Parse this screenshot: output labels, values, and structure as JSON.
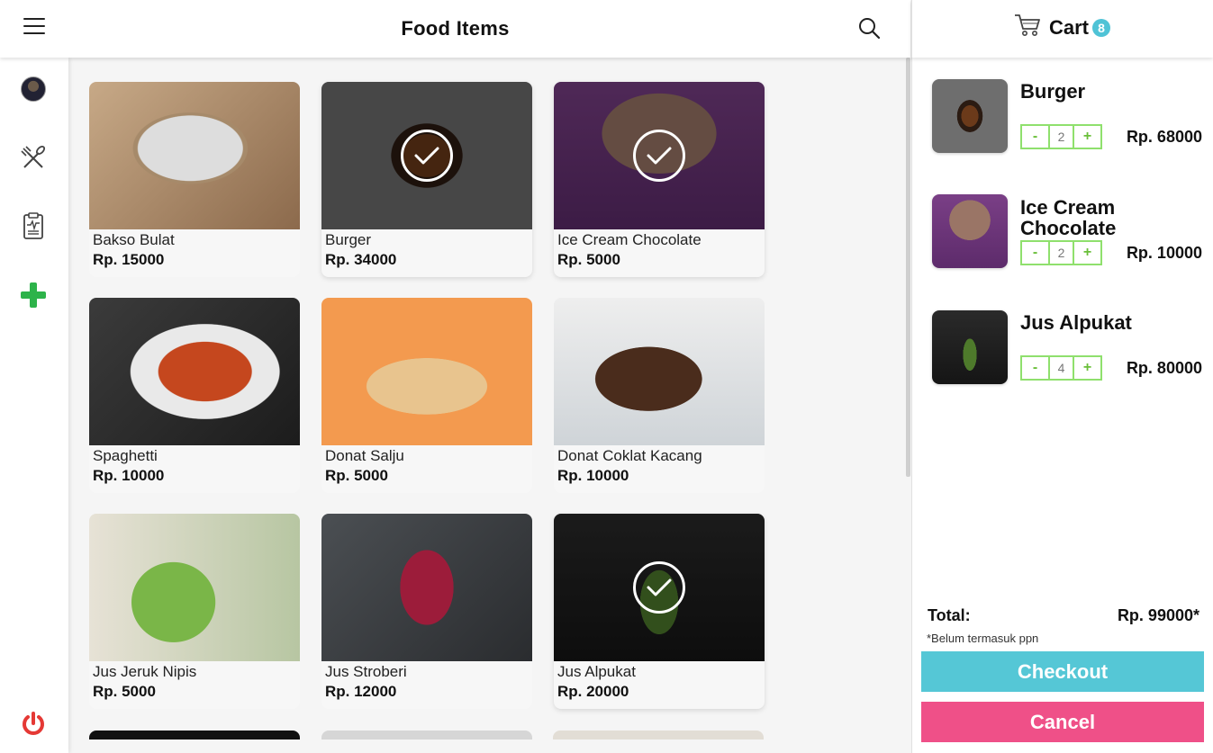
{
  "header": {
    "title": "Food Items"
  },
  "cart_header": {
    "title": "Cart",
    "count": "8"
  },
  "menu": [
    {
      "name": "Bakso Bulat",
      "price": "Rp. 15000",
      "selected": false,
      "img": "img-bakso"
    },
    {
      "name": "Burger",
      "price": "Rp. 34000",
      "selected": true,
      "img": "img-burger"
    },
    {
      "name": "Ice Cream Chocolate",
      "price": "Rp. 5000",
      "selected": true,
      "img": "img-icecream"
    },
    {
      "name": "Spaghetti",
      "price": "Rp. 10000",
      "selected": false,
      "img": "img-spaghetti"
    },
    {
      "name": "Donat Salju",
      "price": "Rp. 5000",
      "selected": false,
      "img": "img-donat"
    },
    {
      "name": "Donat Coklat Kacang",
      "price": "Rp. 10000",
      "selected": false,
      "img": "img-coklat"
    },
    {
      "name": "Jus Jeruk Nipis",
      "price": "Rp. 5000",
      "selected": false,
      "img": "img-jeruk"
    },
    {
      "name": "Jus Stroberi",
      "price": "Rp. 12000",
      "selected": false,
      "img": "img-stroberi"
    },
    {
      "name": "Jus Alpukat",
      "price": "Rp. 20000",
      "selected": true,
      "img": "img-alpukat"
    }
  ],
  "cart": {
    "items": [
      {
        "name": "Burger",
        "qty": "2",
        "price": "Rp. 68000",
        "minus": "-",
        "plus": "+"
      },
      {
        "name": "Ice Cream Chocolate",
        "qty": "2",
        "price": "Rp. 10000",
        "minus": "-",
        "plus": "+"
      },
      {
        "name": "Jus Alpukat",
        "qty": "4",
        "price": "Rp. 80000",
        "minus": "-",
        "plus": "+"
      }
    ],
    "total_label": "Total:",
    "total_value": "Rp. 99000*",
    "note": "*Belum termasuk ppn",
    "checkout_label": "Checkout",
    "cancel_label": "Cancel"
  },
  "colors": {
    "accent_teal": "#55c7d6",
    "cancel_pink": "#ef5088",
    "qty_green": "#8fe06d",
    "add_green": "#2db34a",
    "power_red": "#e53935"
  },
  "icons": {
    "sidebar": [
      "avatar",
      "utensils-icon",
      "report-icon",
      "add-icon",
      "power-icon"
    ],
    "header": [
      "menu-icon",
      "search-icon",
      "cart-icon"
    ]
  }
}
